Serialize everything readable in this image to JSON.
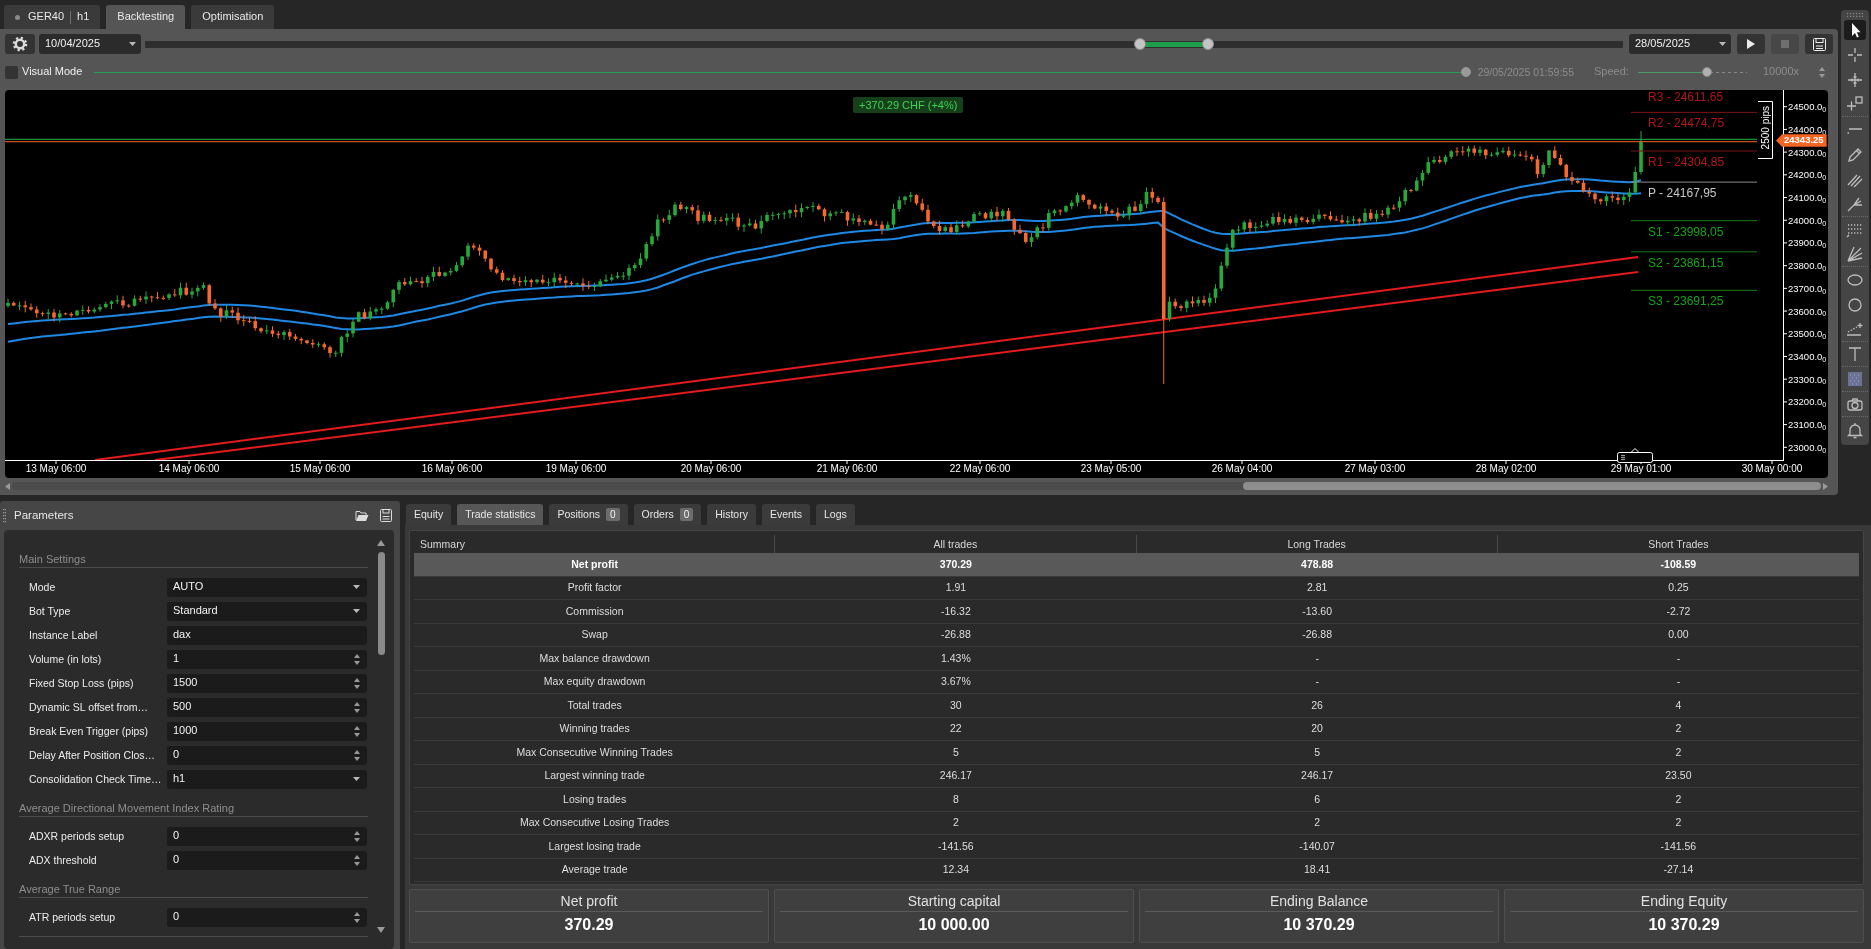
{
  "header_tabs": [
    {
      "kind": "instrument",
      "symbol": "GER40",
      "timeframe": "h1",
      "selected": false
    },
    {
      "kind": "page",
      "label": "Backtesting",
      "selected": true
    },
    {
      "kind": "page",
      "label": "Optimisation",
      "selected": false
    }
  ],
  "toolbar": {
    "start_date": "10/04/2025",
    "range_handles": [
      {
        "level": 0.673
      },
      {
        "level": 0.719
      }
    ],
    "end_date": "28/05/2025",
    "buttons": [
      {
        "kind": "play",
        "disabled": false
      },
      {
        "kind": "stop",
        "disabled": true
      },
      {
        "kind": "save",
        "disabled": false
      }
    ]
  },
  "visual_mode": {
    "label": "Visual Mode",
    "checked": false
  },
  "replay": {
    "level": 1,
    "timestamp": "29/05/2025 01:59:55",
    "disabled": true
  },
  "speed": {
    "label": "Speed:",
    "level": 0.65,
    "value": "10000x",
    "disabled": true
  },
  "chart": {
    "profit_badge": "+370.29 CHF (+4%)",
    "pivots": [
      {
        "kind": "resistance",
        "label": "R3 - 24611,65"
      },
      {
        "kind": "resistance",
        "label": "R2 - 24474,75"
      },
      {
        "kind": "resistance",
        "label": "R1 - 24304,85"
      },
      {
        "kind": "pivot",
        "label": "P - 24167,95"
      },
      {
        "kind": "support",
        "label": "S1 - 23998,05"
      },
      {
        "kind": "support",
        "label": "S2 - 23861,15"
      },
      {
        "kind": "support",
        "label": "S3 - 23691,25"
      }
    ],
    "ruler_label": "2500 pips",
    "current_price": "24343.25",
    "price_axis": [
      "24500.0$_{0}$",
      "24400.0$_{0}$",
      "24300.0$_{0}$",
      "24200.0$_{0}$",
      "24100.0$_{0}$",
      "24000.0$_{0}$",
      "23900.0$_{0}$",
      "23800.0$_{0}$",
      "23700.0$_{0}$",
      "23600.0$_{0}$",
      "23500.0$_{0}$",
      "23400.0$_{0}$",
      "23300.0$_{0}$",
      "23200.0$_{0}$",
      "23100.0$_{0}$",
      "23000.0$_{0}$"
    ],
    "time_axis": [
      "13 May 06:00",
      "14 May 06:00",
      "15 May 06:00",
      "16 May 06:00",
      "19 May 06:00",
      "20 May 06:00",
      "21 May 06:00",
      "22 May 06:00",
      "23 May 05:00",
      "26 May 04:00",
      "27 May 03:00",
      "28 May 02:00",
      "29 May 01:00",
      "30 May 00:00"
    ]
  },
  "drawing_tools": [
    {
      "kind": "arrow",
      "selected": true
    },
    {
      "kind": "crosshair",
      "selected": false
    },
    {
      "kind": "ticks",
      "selected": false
    },
    {
      "kind": "square",
      "selected": false
    },
    {
      "kind": "hline",
      "selected": false
    },
    {
      "kind": "pen",
      "selected": false
    },
    {
      "kind": "hatch",
      "selected": false
    },
    {
      "kind": "pitchfork",
      "selected": false
    },
    {
      "kind": "grid",
      "selected": false
    },
    {
      "kind": "fan",
      "selected": false
    },
    {
      "kind": "ellipse",
      "selected": false
    },
    {
      "kind": "circle",
      "selected": false
    },
    {
      "kind": "lineplus",
      "selected": false
    },
    {
      "kind": "text",
      "selected": false
    },
    {
      "kind": "pattern",
      "selected": false
    },
    {
      "kind": "camera",
      "selected": false
    },
    {
      "kind": "bell",
      "selected": false
    }
  ],
  "parameters": {
    "title": "Parameters",
    "sections": [
      {
        "title": "Main Settings",
        "fields": [
          {
            "label": "Mode",
            "kind": "select",
            "value": "AUTO"
          },
          {
            "label": "Bot Type",
            "kind": "select",
            "value": "Standard"
          },
          {
            "label": "Instance Label",
            "kind": "text",
            "value": "dax"
          },
          {
            "label": "Volume (in lots)",
            "kind": "number",
            "value": "1"
          },
          {
            "label": "Fixed Stop Loss (pips)",
            "kind": "number",
            "value": "1500"
          },
          {
            "label": "Dynamic SL offset from…",
            "kind": "number",
            "value": "500"
          },
          {
            "label": "Break Even Trigger (pips)",
            "kind": "number",
            "value": "1000"
          },
          {
            "label": "Delay After Position Clos…",
            "kind": "number",
            "value": "0"
          },
          {
            "label": "Consolidation Check Time…",
            "kind": "select",
            "value": "h1"
          }
        ]
      },
      {
        "title": "Average Directional Movement Index Rating",
        "fields": [
          {
            "label": "ADXR periods setup",
            "kind": "number",
            "value": "0"
          },
          {
            "label": "ADX threshold",
            "kind": "number",
            "value": "0"
          }
        ]
      },
      {
        "title": "Average True Range",
        "fields": [
          {
            "label": "ATR periods setup",
            "kind": "number",
            "value": "0"
          }
        ]
      }
    ]
  },
  "results": {
    "tabs": [
      {
        "label": "Equity",
        "selected": false
      },
      {
        "label": "Trade statistics",
        "selected": true
      },
      {
        "label": "Positions",
        "count": "0",
        "selected": false
      },
      {
        "label": "Orders",
        "count": "0",
        "selected": false
      },
      {
        "label": "History",
        "selected": false
      },
      {
        "label": "Events",
        "selected": false
      },
      {
        "label": "Logs",
        "selected": false
      }
    ],
    "table": {
      "columns": [
        "Summary",
        "All trades",
        "Long Trades",
        "Short Trades"
      ],
      "rows": [
        {
          "cells": [
            "Net profit",
            "370.29",
            "478.88",
            "-108.59"
          ],
          "selected": true
        },
        {
          "cells": [
            "Profit factor",
            "1.91",
            "2.81",
            "0.25"
          ],
          "selected": false
        },
        {
          "cells": [
            "Commission",
            "-16.32",
            "-13.60",
            "-2.72"
          ],
          "selected": false
        },
        {
          "cells": [
            "Swap",
            "-26.88",
            "-26.88",
            "0.00"
          ],
          "selected": false
        },
        {
          "cells": [
            "Max balance drawdown",
            "1.43%",
            "-",
            "-"
          ],
          "selected": false
        },
        {
          "cells": [
            "Max equity drawdown",
            "3.67%",
            "-",
            "-"
          ],
          "selected": false
        },
        {
          "cells": [
            "Total trades",
            "30",
            "26",
            "4"
          ],
          "selected": false
        },
        {
          "cells": [
            "Winning trades",
            "22",
            "20",
            "2"
          ],
          "selected": false
        },
        {
          "cells": [
            "Max Consecutive Winning Trades",
            "5",
            "5",
            "2"
          ],
          "selected": false
        },
        {
          "cells": [
            "Largest winning trade",
            "246.17",
            "246.17",
            "23.50"
          ],
          "selected": false
        },
        {
          "cells": [
            "Losing trades",
            "8",
            "6",
            "2"
          ],
          "selected": false
        },
        {
          "cells": [
            "Max Consecutive Losing Trades",
            "2",
            "2",
            "2"
          ],
          "selected": false
        },
        {
          "cells": [
            "Largest losing trade",
            "-141.56",
            "-140.07",
            "-141.56"
          ],
          "selected": false
        },
        {
          "cells": [
            "Average trade",
            "12.34",
            "18.41",
            "-27.14"
          ],
          "selected": false
        }
      ]
    },
    "summary_cards": [
      {
        "title": "Net profit",
        "value": "370.29"
      },
      {
        "title": "Starting capital",
        "value": "10 000.00"
      },
      {
        "title": "Ending Balance",
        "value": "10 370.29"
      },
      {
        "title": "Ending Equity",
        "value": "10 370.29"
      }
    ]
  }
}
